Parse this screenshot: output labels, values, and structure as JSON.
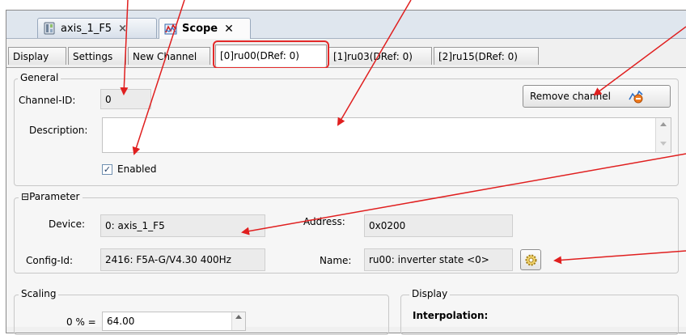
{
  "doc_tabs": [
    {
      "label": "axis_1_F5",
      "close": "×"
    },
    {
      "label": "Scope",
      "close": "✕"
    }
  ],
  "subtabs": [
    {
      "label": "Display"
    },
    {
      "label": "Settings"
    },
    {
      "label": "New Channel"
    },
    {
      "label": "[0]ru00(DRef: 0)"
    },
    {
      "label": "[1]ru03(DRef: 0)"
    },
    {
      "label": "[2]ru15(DRef: 0)"
    }
  ],
  "general": {
    "title": "General",
    "channel_id_label": "Channel-ID:",
    "channel_id_value": "0",
    "remove_label": "Remove channel",
    "description_label": "Description:",
    "description_value": "",
    "enabled_label": "Enabled",
    "enabled_check": "✓"
  },
  "parameter": {
    "collapse": "⊟",
    "title": "Parameter",
    "device_label": "Device:",
    "device_value": "0: axis_1_F5",
    "address_label": "Address:",
    "address_value": "0x0200",
    "configid_label": "Config-Id:",
    "configid_value": "2416: F5A-G/V4.30 400Hz",
    "name_label": "Name:",
    "name_value": "ru00: inverter state <0>"
  },
  "scaling": {
    "title": "Scaling",
    "row_label": "0 % =",
    "row_value": "64.00"
  },
  "display": {
    "title": "Display",
    "interpolation_label": "Interpolation:"
  },
  "colors": {
    "annotation": "#e01f1f",
    "highlight": "#e32a2a"
  }
}
